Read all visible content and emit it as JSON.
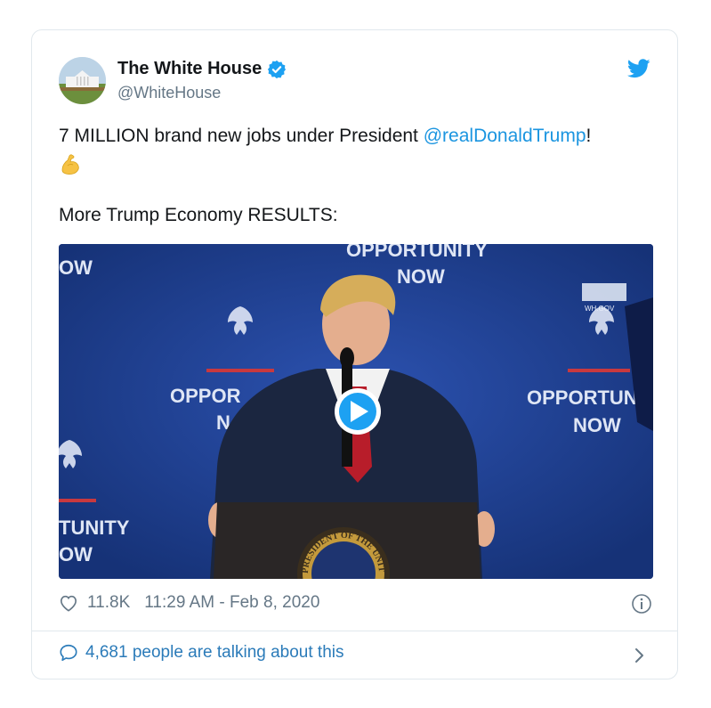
{
  "account": {
    "name": "The White House",
    "handle": "@WhiteHouse",
    "verified": true
  },
  "tweet": {
    "text_before": "7 MILLION brand new jobs under President ",
    "mention": "@realDonaldTrump",
    "text_after": "!",
    "emoji": "flexed-biceps",
    "line2": "More Trump Economy RESULTS:"
  },
  "media": {
    "type": "video",
    "backdrop_texts": {
      "top_left": "OW",
      "top_center_1": "OPPORTUNITY",
      "top_center_2": "NOW",
      "mid_left_1": "OPPOR",
      "mid_left_2": "N",
      "mid_right_1": "OPPORTUNI",
      "mid_right_2": "NOW",
      "bottom_left_1": "TUNITY",
      "bottom_left_2": "OW",
      "watermark": "WH.GOV",
      "seal_text": "PRESIDENT OF THE UNITED"
    }
  },
  "footer": {
    "likes": "11.8K",
    "timestamp": "11:29 AM - Feb 8, 2020",
    "talking": "4,681 people are talking about this"
  },
  "colors": {
    "link": "#1b95e0",
    "muted": "#657786",
    "talk": "#2b7bb9",
    "backdrop": "#1a3a8c"
  }
}
